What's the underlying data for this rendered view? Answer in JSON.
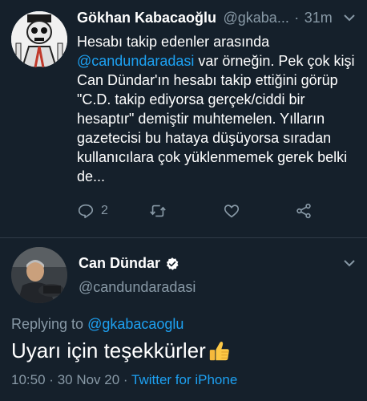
{
  "tweet1": {
    "author_name": "Gökhan Kabacaoğlu",
    "handle": "@gkaba...",
    "separator": "·",
    "time": "31m",
    "text_before": "Hesabı takip edenler arasında ",
    "mention": "@candundaradasi",
    "text_after": " var örneğin. Pek çok kişi Can Dündar'ın hesabı takip ettiğini görüp \"C.D. takip ediyorsa gerçek/ciddi bir hesaptır\" demiştir muhtemelen. Yılların gazetecisi bu hataya düşüyorsa sıradan kullanıcılara çok yüklenmemek gerek belki de...",
    "actions": {
      "reply_icon": "reply-icon",
      "reply_count": "2",
      "retweet_icon": "retweet-icon",
      "like_icon": "heart-icon",
      "share_icon": "share-icon"
    }
  },
  "tweet2": {
    "author_name": "Can Dündar",
    "verified_icon": "verified-badge-icon",
    "handle": "@candundaradasi",
    "replying_label": "Replying to ",
    "replying_to": "@gkabacaoglu",
    "text": "Uyarı için teşekkürler",
    "emoji_icon": "thumbs-up-icon",
    "time": "10:50",
    "separator": "·",
    "date": "30 Nov 20",
    "source": "Twitter for iPhone"
  },
  "colors": {
    "background": "#15202b",
    "link": "#1da1f2",
    "secondary_text": "#8899a6"
  }
}
